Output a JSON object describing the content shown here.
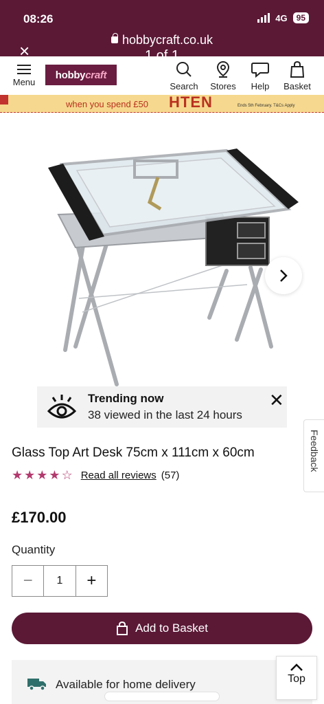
{
  "status_bar": {
    "time": "08:26",
    "network": "4G",
    "battery": "95"
  },
  "browser": {
    "url": "hobbycraft.co.uk",
    "page_counter": "1 of 1",
    "close": "×"
  },
  "header": {
    "logo_part1": "hobby",
    "logo_part2": "craft",
    "menu_label": "Menu",
    "nav": {
      "search": "Search",
      "stores": "Stores",
      "help": "Help",
      "basket": "Basket"
    }
  },
  "promo": {
    "text": "when you spend £50",
    "code": "HTEN",
    "small_print": "Ends 5th February. T&Cs Apply"
  },
  "trending": {
    "title": "Trending now",
    "subtitle": "38 viewed in the last 24 hours",
    "close": "✕"
  },
  "feedback_label": "Feedback",
  "product": {
    "title": "Glass Top Art Desk 75cm x 111cm x 60cm",
    "rating": 4.5,
    "reviews_link": "Read all reviews",
    "reviews_count": "(57)",
    "price": "£170.00",
    "quantity_label": "Quantity",
    "quantity": "1",
    "minus": "−",
    "plus": "+",
    "add_to_basket": "Add to Basket"
  },
  "delivery": {
    "text": "Available for home delivery"
  },
  "top_button": "Top",
  "colors": {
    "brand": "#5b1936",
    "star": "#b23a6e",
    "promo_bg": "#f6d98f",
    "promo_text": "#b9311f"
  }
}
